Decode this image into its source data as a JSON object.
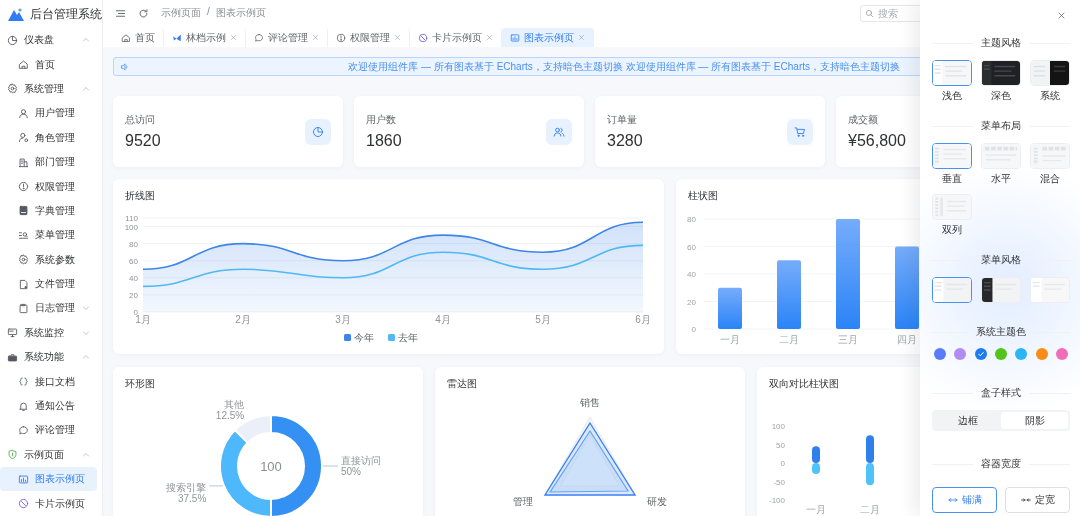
{
  "sidebar": {
    "logo": "后台管理系统",
    "items": [
      {
        "label": "仪表盘",
        "selected": false,
        "expanded": true,
        "children": [
          {
            "label": "首页",
            "selected": false
          }
        ]
      },
      {
        "label": "系统管理",
        "selected": false,
        "expanded": true,
        "children": [
          {
            "label": "用户管理",
            "selected": false
          },
          {
            "label": "角色管理",
            "selected": false
          },
          {
            "label": "部门管理",
            "selected": false
          },
          {
            "label": "权限管理",
            "selected": false
          },
          {
            "label": "字典管理",
            "selected": false
          },
          {
            "label": "菜单管理",
            "selected": false
          },
          {
            "label": "系统参数",
            "selected": false
          },
          {
            "label": "文件管理",
            "selected": false
          },
          {
            "label": "日志管理",
            "selected": false,
            "expanded": false
          }
        ]
      },
      {
        "label": "系统监控",
        "selected": false,
        "expanded": false
      },
      {
        "label": "系统功能",
        "selected": false,
        "expanded": true,
        "children": [
          {
            "label": "接口文档",
            "selected": false
          },
          {
            "label": "通知公告",
            "selected": false
          },
          {
            "label": "评论管理",
            "selected": false
          }
        ]
      },
      {
        "label": "示例页面",
        "selected": false,
        "expanded": true,
        "children": [
          {
            "label": "图表示例页",
            "selected": true
          },
          {
            "label": "卡片示例页",
            "selected": false
          }
        ]
      }
    ]
  },
  "header": {
    "breadcrumb": [
      "示例页面",
      "图表示例页"
    ],
    "breadcrumb_separator": "/",
    "search": {
      "placeholder": "搜索"
    }
  },
  "tabs": [
    {
      "label": "首页",
      "selected": false,
      "closable": false
    },
    {
      "label": "林档示例",
      "selected": false,
      "closable": true
    },
    {
      "label": "评论管理",
      "selected": false,
      "closable": true
    },
    {
      "label": "权限管理",
      "selected": false,
      "closable": true
    },
    {
      "label": "卡片示例页",
      "selected": false,
      "closable": true
    },
    {
      "label": "图表示例页",
      "selected": true,
      "closable": true
    }
  ],
  "notice": {
    "text": "欢迎使用组件库 — 所有图表基于 ECharts，支持暗色主题切换 欢迎使用组件库 — 所有图表基于 ECharts，支持暗色主题切换"
  },
  "stats": [
    {
      "label": "总访问",
      "value": "9520"
    },
    {
      "label": "用户数",
      "value": "1860"
    },
    {
      "label": "订单量",
      "value": "3280"
    },
    {
      "label": "成交额",
      "value": "¥56,800"
    }
  ],
  "line_chart": {
    "chart_data": {
      "type": "area",
      "title": "折线图",
      "grid": true,
      "legend": "bottom",
      "categories": [
        "1月",
        "2月",
        "3月",
        "4月",
        "5月",
        "6月"
      ],
      "ylim": [
        0,
        110
      ],
      "yticks": [
        0,
        20,
        40,
        60,
        80,
        100,
        110
      ],
      "series": [
        {
          "name": "今年",
          "color": "#3d85e8",
          "values": [
            50,
            80,
            60,
            90,
            70,
            105
          ]
        },
        {
          "name": "去年",
          "type": "line",
          "color": "#4fb8f5",
          "values": [
            30,
            50,
            40,
            70,
            50,
            78
          ]
        }
      ]
    }
  },
  "bar_chart": {
    "chart_data": {
      "type": "bar",
      "title": "柱状图",
      "categories": [
        "一月",
        "二月",
        "三月",
        "四月"
      ],
      "values": [
        30,
        50,
        80,
        60
      ],
      "grid": true,
      "ylim": [
        0,
        80
      ],
      "yticks": [
        0,
        20,
        40,
        60,
        80
      ]
    }
  },
  "donut_chart": {
    "center_label": "100",
    "chart_data": {
      "type": "donut",
      "title": "环形图",
      "categories": [
        "直接访问",
        "搜索引擎",
        "其他"
      ],
      "values": [
        50,
        37.5,
        12.5
      ],
      "value_labels": [
        "50%",
        "37.5%",
        "12.5%"
      ]
    }
  },
  "radar_chart": {
    "title": "雷达图",
    "axes": [
      "销售",
      "研发",
      "管理"
    ]
  },
  "compare_chart": {
    "chart_data": {
      "type": "bar",
      "title": "双向对比柱状图",
      "categories": [
        "一月",
        "二月"
      ],
      "stacked": true,
      "ylim": [
        -100,
        100
      ],
      "yticks": [
        -100,
        -50,
        0,
        50,
        100
      ],
      "series": [
        {
          "color": "#2f80ed",
          "values": [
            45,
            75
          ]
        },
        {
          "color": "#4fc3f7",
          "values": [
            -30,
            -60
          ]
        }
      ]
    }
  },
  "settings": {
    "sections": [
      {
        "kind": "thumbnails",
        "title": "主题风格",
        "options": [
          {
            "kind": "light",
            "label": "浅色",
            "selected": true
          },
          {
            "kind": "dark",
            "label": "深色",
            "selected": false
          },
          {
            "kind": "split",
            "label": "系统",
            "selected": false
          }
        ]
      },
      {
        "kind": "thumbnails",
        "title": "菜单布局",
        "options": [
          {
            "kind": "vertical",
            "label": "垂直",
            "selected": true
          },
          {
            "kind": "horizontal",
            "label": "水平",
            "selected": false
          },
          {
            "kind": "mixed",
            "label": "混合",
            "selected": false
          },
          {
            "kind": "columns",
            "label": "双列",
            "selected": false
          }
        ]
      },
      {
        "kind": "thumbnails",
        "title": "菜单风格",
        "options": [
          {
            "kind": "lightmenu",
            "selected": true
          },
          {
            "kind": "darkmenu",
            "selected": false
          },
          {
            "kind": "plainmenu",
            "selected": false
          }
        ]
      },
      {
        "kind": "colors",
        "title": "系统主题色",
        "options": [
          {
            "color": "#5b7cfa",
            "selected": false
          },
          {
            "color": "#b08cf3",
            "selected": false
          },
          {
            "color": "#1e7cf2",
            "selected": true
          },
          {
            "color": "#52c41a",
            "selected": false
          },
          {
            "color": "#2bb5f5",
            "selected": false
          },
          {
            "color": "#fa8c16",
            "selected": false
          },
          {
            "color": "#f06db8",
            "selected": false
          }
        ]
      },
      {
        "kind": "segmented",
        "title": "盒子样式",
        "options": [
          {
            "label": "边框",
            "selected": false
          },
          {
            "label": "阴影",
            "selected": true
          }
        ]
      },
      {
        "kind": "buttons",
        "title": "容器宽度",
        "options": [
          {
            "kind": "full",
            "label": "铺满",
            "selected": true
          },
          {
            "kind": "fixed",
            "label": "定宽",
            "selected": false
          }
        ]
      }
    ]
  }
}
